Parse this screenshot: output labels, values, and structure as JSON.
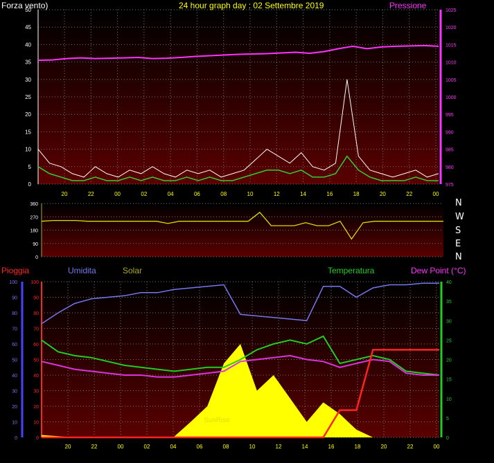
{
  "header": {
    "wind_label": "Forza vento)",
    "title": "24 hour graph day : 02 Settembre 2019",
    "pressure_label": "Pressione"
  },
  "compass": [
    "N",
    "W",
    "S",
    "E",
    "N"
  ],
  "bottom_labels": {
    "rain": "Pioggia",
    "humidity": "Umidita",
    "solar": "Solar",
    "temperature": "Temperatura",
    "dewpoint": "Dew Point (°C)",
    "sunrise": "SunRise"
  },
  "colors": {
    "wind": "#ffffff",
    "wind_avg": "#33cc33",
    "pressure": "#ff33ff",
    "direction": "#dddd00",
    "humidity": "#7777ee",
    "temperature": "#22cc22",
    "dewpoint": "#dd33dd",
    "solar": "#ffff00",
    "rain": "#ff2222"
  },
  "chart_data": [
    {
      "type": "line",
      "name_ref": "wind-pressure",
      "x_ticks": [
        "20",
        "22",
        "00",
        "02",
        "04",
        "06",
        "08",
        "10",
        "12",
        "14",
        "16",
        "18",
        "20",
        "22",
        "00"
      ],
      "ylim_left": [
        0,
        50
      ],
      "yticks_left": [
        0,
        5,
        10,
        15,
        20,
        25,
        30,
        35,
        40,
        45,
        50
      ],
      "ylim_right": [
        975,
        1025
      ],
      "yticks_right": [
        975,
        980,
        985,
        990,
        995,
        1000,
        1005,
        1010,
        1015,
        1020,
        1025
      ],
      "pressure": [
        1010.5,
        1010.6,
        1011,
        1011.2,
        1011.0,
        1011.1,
        1011.2,
        1011.3,
        1011.0,
        1011.1,
        1011.3,
        1011.6,
        1011.8,
        1012,
        1012.2,
        1012.3,
        1012.4,
        1012.6,
        1012.8,
        1012.5,
        1013,
        1013.8,
        1014.5,
        1013.8,
        1014.3,
        1014.5,
        1014.6,
        1014.7,
        1014.5
      ],
      "wind_gust": [
        10,
        6,
        5,
        3,
        2,
        5,
        3,
        2,
        4,
        3,
        5,
        3,
        2,
        4,
        3,
        4,
        2,
        3,
        4,
        7,
        10,
        8,
        6,
        9,
        5,
        4,
        6,
        30,
        8,
        4,
        3,
        2,
        3,
        4,
        2,
        3
      ],
      "wind_avg": [
        5,
        3,
        2,
        1,
        1,
        2,
        1,
        1,
        2,
        1,
        2,
        1,
        1,
        2,
        1,
        2,
        1,
        1,
        2,
        3,
        4,
        4,
        3,
        4,
        2,
        2,
        3,
        8,
        4,
        2,
        1,
        1,
        1,
        2,
        1,
        1
      ]
    },
    {
      "type": "line",
      "name_ref": "wind-direction",
      "x_ticks": [],
      "ylim": [
        0,
        360
      ],
      "yticks": [
        0,
        90,
        180,
        270,
        360
      ],
      "direction": [
        240,
        245,
        245,
        245,
        240,
        240,
        240,
        240,
        240,
        240,
        240,
        225,
        240,
        240,
        240,
        240,
        240,
        240,
        240,
        300,
        210,
        210,
        210,
        230,
        210,
        210,
        240,
        120,
        230,
        240,
        240,
        240,
        240,
        240,
        240,
        240
      ]
    },
    {
      "type": "line",
      "name_ref": "temp-humidity-solar-rain",
      "x_ticks": [
        "20",
        "22",
        "00",
        "02",
        "04",
        "06",
        "08",
        "10",
        "12",
        "14",
        "16",
        "18",
        "20",
        "22",
        "00"
      ],
      "ylim_left": [
        0,
        100
      ],
      "yticks_left": [
        0,
        10,
        20,
        30,
        40,
        50,
        60,
        70,
        80,
        90,
        100
      ],
      "ylim_right": [
        0,
        40
      ],
      "yticks_right": [
        0,
        5,
        10,
        15,
        20,
        25,
        30,
        35,
        40
      ],
      "humidity": [
        73,
        80,
        86,
        89,
        90,
        91,
        93,
        93,
        95,
        96,
        97,
        98,
        79,
        78,
        77,
        76,
        75,
        97,
        97,
        90,
        96,
        98,
        98,
        99,
        99
      ],
      "temperature": [
        25,
        22,
        21,
        20.5,
        19.5,
        18.5,
        18,
        17.5,
        17,
        17.5,
        18,
        18,
        20,
        22.5,
        24,
        25,
        24,
        26,
        19,
        20,
        21,
        20,
        17,
        16.5,
        16
      ],
      "dewpoint": [
        19.5,
        18.5,
        17.5,
        17,
        16.5,
        16,
        16,
        15.5,
        15.5,
        16,
        16.5,
        17,
        19.5,
        20,
        20.5,
        21,
        20,
        19.5,
        18,
        19,
        20,
        19.5,
        16.5,
        16,
        16
      ],
      "solar": [
        3,
        1.5,
        0,
        0,
        0,
        0,
        0,
        0,
        1,
        20,
        40,
        95,
        120,
        60,
        80,
        50,
        20,
        45,
        30,
        10,
        0,
        0,
        0,
        0,
        0
      ],
      "rain": [
        0,
        0,
        0,
        0,
        0,
        0,
        0,
        0,
        0,
        0,
        0,
        0,
        0,
        0,
        0,
        0,
        0,
        0,
        7,
        7,
        22.5,
        22.5,
        22.5,
        22.5,
        22.5
      ]
    }
  ]
}
